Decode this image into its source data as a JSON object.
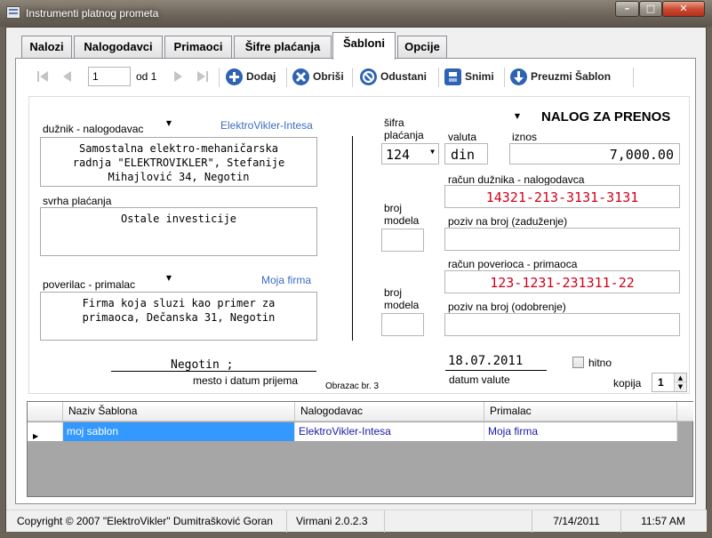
{
  "window": {
    "title": "Instrumenti platnog prometa"
  },
  "tabs": [
    "Nalozi",
    "Nalogodavci",
    "Primaoci",
    "Šifre plaćanja",
    "Šabloni",
    "Opcije"
  ],
  "toolbar": {
    "page_value": "1",
    "page_of": "od 1",
    "add_label": "Dodaj",
    "delete_label": "Obriši",
    "cancel_label": "Odustani",
    "save_label": "Snimi",
    "template_label": "Preuzmi Šablon"
  },
  "form": {
    "heading": "NALOG ZA PRENOS",
    "debtor_label": "dužnik - nalogodavac",
    "debtor_link": "ElektroVikler-Intesa",
    "debtor_text": "Samostalna elektro-mehaničarska radnja \"ELEKTROVIKLER\", Stefanije Mihajlović 34, Negotin",
    "purpose_label": "svrha plaćanja",
    "purpose_text": "Ostale investicije",
    "creditor_label": "poverilac - primalac",
    "creditor_link": "Moja firma",
    "creditor_text": "Firma koja sluzi kao primer za primaoca, Dečanska 31, Negotin",
    "place_value": "Negotin ;",
    "place_label": "mesto i datum prijema",
    "form_number": "Obrazac br. 3",
    "payment_code_label": "šifra plaćanja",
    "payment_code_value": "124",
    "currency_label": "valuta",
    "currency_value": "din",
    "amount_label": "iznos",
    "amount_value": "7,000.00",
    "debtor_account_label": "račun dužnika - nalogodavca",
    "debtor_account_value": "14321-213-3131-3131",
    "model_label": "broj modela",
    "debit_ref_label": "poziv na broj (zaduženje)",
    "creditor_account_label": "račun poverioca - primaoca",
    "creditor_account_value": "123-1231-231311-22",
    "credit_ref_label": "poziv na broj (odobrenje)",
    "value_date": "18.07.2011",
    "value_date_label": "datum valute",
    "urgent_label": "hitno",
    "copies_label": "kopija",
    "copies_value": "1"
  },
  "grid": {
    "columns": [
      "Naziv Šablona",
      "Nalogodavac",
      "Primalac"
    ],
    "rows": [
      {
        "name": "moj sablon",
        "payer": "ElektroVikler-Intesa",
        "payee": "Moja firma"
      }
    ]
  },
  "status": {
    "copyright": "Copyright © 2007 \"ElektroVikler\" Dumitrašković Goran",
    "version": "Virmani 2.0.2.3",
    "date": "7/14/2011",
    "time": "11:57 AM"
  },
  "colors": {
    "accent": "#3c6cc0",
    "account_red": "#d0021b",
    "selected_row": "#3399ff"
  }
}
